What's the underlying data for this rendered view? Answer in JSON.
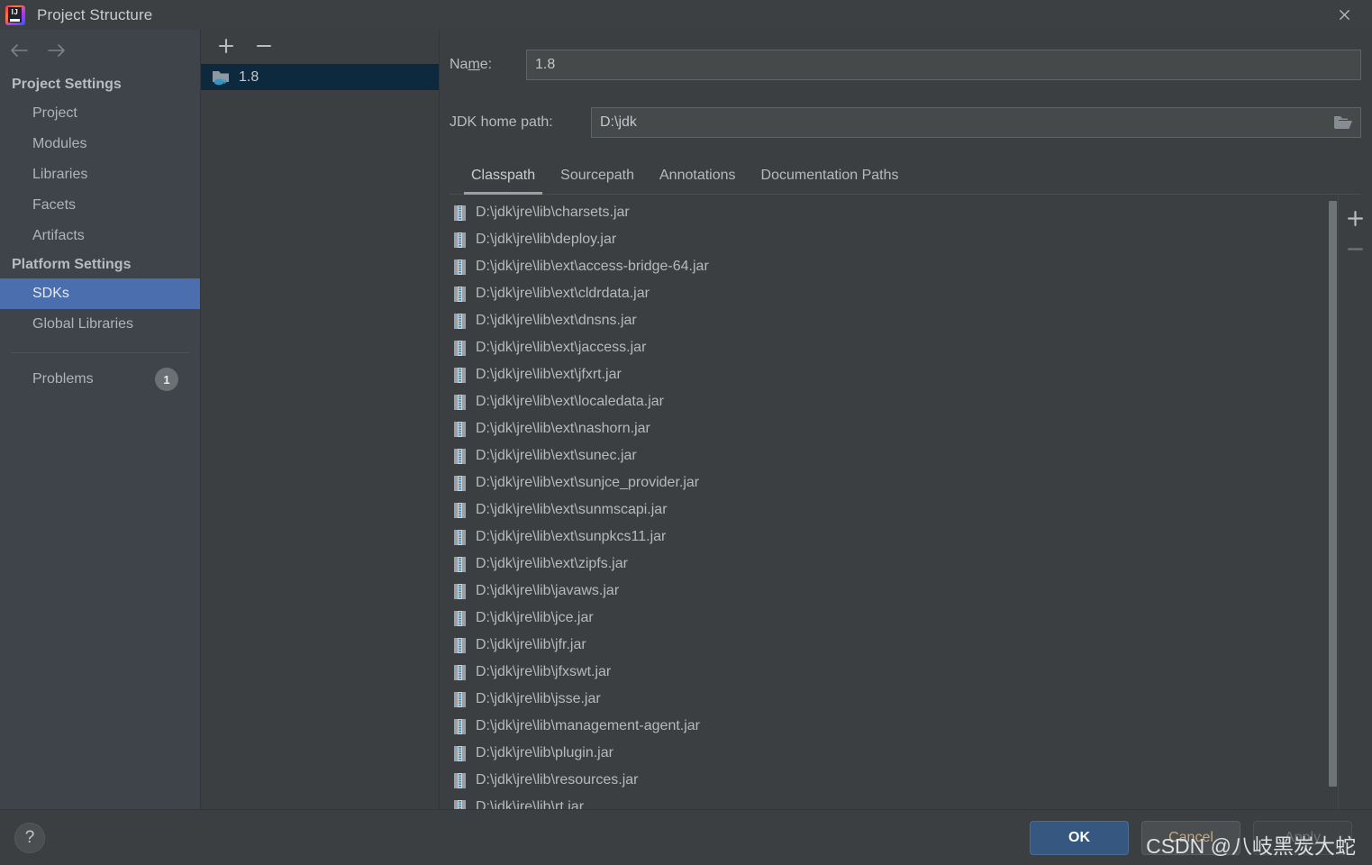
{
  "window": {
    "title": "Project Structure",
    "logo_icon": "intellij-idea-logo",
    "close_icon": "close-icon"
  },
  "nav": {
    "back_icon": "arrow-left-icon",
    "forward_icon": "arrow-right-icon"
  },
  "sidebar": {
    "groups": [
      {
        "header": "Project Settings",
        "items": [
          {
            "label": "Project",
            "selected": false
          },
          {
            "label": "Modules",
            "selected": false
          },
          {
            "label": "Libraries",
            "selected": false
          },
          {
            "label": "Facets",
            "selected": false
          },
          {
            "label": "Artifacts",
            "selected": false
          }
        ]
      },
      {
        "header": "Platform Settings",
        "items": [
          {
            "label": "SDKs",
            "selected": true
          },
          {
            "label": "Global Libraries",
            "selected": false
          }
        ]
      }
    ],
    "problems": {
      "label": "Problems",
      "count": "1"
    }
  },
  "sdk_panel": {
    "add_icon": "plus-icon",
    "remove_icon": "minus-icon",
    "items": [
      {
        "label": "1.8",
        "icon": "jdk-folder-icon",
        "selected": true
      }
    ]
  },
  "details": {
    "name_label_before": "Na",
    "name_label_mnemonic": "m",
    "name_label_after": "e:",
    "name_value": "1.8",
    "jdk_path_label": "JDK home path:",
    "jdk_path_value": "D:\\jdk",
    "browse_icon": "folder-open-icon"
  },
  "tabs": [
    {
      "label": "Classpath",
      "active": true
    },
    {
      "label": "Sourcepath",
      "active": false
    },
    {
      "label": "Annotations",
      "active": false
    },
    {
      "label": "Documentation Paths",
      "active": false
    }
  ],
  "classpath": {
    "add_icon": "plus-icon",
    "remove_icon": "minus-icon",
    "entry_icon": "jar-archive-icon",
    "entries": [
      "D:\\jdk\\jre\\lib\\charsets.jar",
      "D:\\jdk\\jre\\lib\\deploy.jar",
      "D:\\jdk\\jre\\lib\\ext\\access-bridge-64.jar",
      "D:\\jdk\\jre\\lib\\ext\\cldrdata.jar",
      "D:\\jdk\\jre\\lib\\ext\\dnsns.jar",
      "D:\\jdk\\jre\\lib\\ext\\jaccess.jar",
      "D:\\jdk\\jre\\lib\\ext\\jfxrt.jar",
      "D:\\jdk\\jre\\lib\\ext\\localedata.jar",
      "D:\\jdk\\jre\\lib\\ext\\nashorn.jar",
      "D:\\jdk\\jre\\lib\\ext\\sunec.jar",
      "D:\\jdk\\jre\\lib\\ext\\sunjce_provider.jar",
      "D:\\jdk\\jre\\lib\\ext\\sunmscapi.jar",
      "D:\\jdk\\jre\\lib\\ext\\sunpkcs11.jar",
      "D:\\jdk\\jre\\lib\\ext\\zipfs.jar",
      "D:\\jdk\\jre\\lib\\javaws.jar",
      "D:\\jdk\\jre\\lib\\jce.jar",
      "D:\\jdk\\jre\\lib\\jfr.jar",
      "D:\\jdk\\jre\\lib\\jfxswt.jar",
      "D:\\jdk\\jre\\lib\\jsse.jar",
      "D:\\jdk\\jre\\lib\\management-agent.jar",
      "D:\\jdk\\jre\\lib\\plugin.jar",
      "D:\\jdk\\jre\\lib\\resources.jar",
      "D:\\jdk\\jre\\lib\\rt.jar"
    ]
  },
  "footer": {
    "help_label": "?",
    "ok_label": "OK",
    "cancel_label": "Cancel",
    "apply_label": "Apply"
  },
  "watermark": "CSDN @八岐黑炭大蛇",
  "colors": {
    "background": "#3C3F41",
    "sidebar_background": "#3F434A",
    "selection_blue": "#4B6EAF",
    "tree_selection": "#0D293E",
    "primary_button": "#365880",
    "text": "#b6babd"
  }
}
